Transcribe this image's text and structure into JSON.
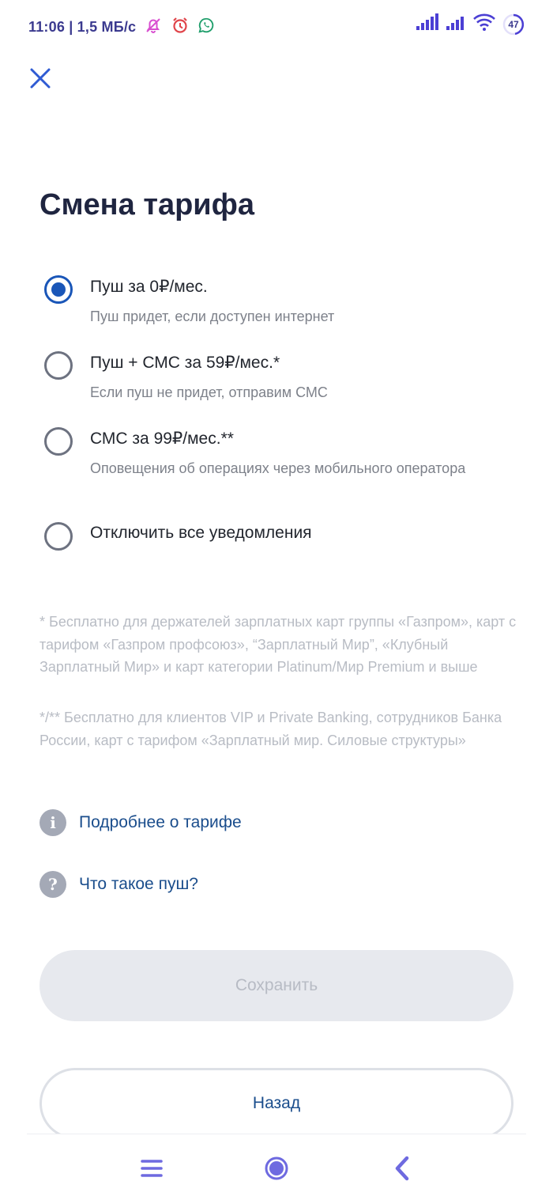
{
  "status_bar": {
    "time_speed": "11:06 | 1,5 МБ/с",
    "battery": "47"
  },
  "title": "Смена тарифа",
  "options": [
    {
      "label": "Пуш за 0₽/мес.",
      "description": "Пуш придет, если доступен интернет",
      "selected": true
    },
    {
      "label": "Пуш + СМС за 59₽/мес.*",
      "description": "Если пуш не придет, отправим СМС",
      "selected": false
    },
    {
      "label": "СМС за 99₽/мес.**",
      "description": "Оповещения об операциях через мобильного оператора",
      "selected": false
    },
    {
      "label": "Отключить все уведомления",
      "description": "",
      "selected": false
    }
  ],
  "footnotes": [
    "* Бесплатно для держателей зарплатных карт группы «Газпром», карт с тарифом «Газпром профсоюз», “Зарплатный Мир”, «Клубный Зарплатный Мир» и карт категории Platinum/Мир Premium и выше",
    "*/** Бесплатно для клиентов VIP и Private Banking, сотрудников Банка России, карт с тарифом «Зарплатный мир. Силовые структуры»"
  ],
  "links": {
    "tariff_info": "Подробнее о тарифе",
    "what_is_push": "Что такое пуш?"
  },
  "buttons": {
    "save": "Сохранить",
    "back": "Назад"
  },
  "colors": {
    "accent": "#1a56b8",
    "link": "#1a4d8c",
    "title": "#1f2540",
    "nav_icons": "#6e6ae0"
  },
  "icons": {
    "close": "close-icon",
    "info": "info-icon",
    "help": "question-icon",
    "nav_menu": "menu-icon",
    "nav_home": "home-circle-icon",
    "nav_back": "back-chevron-icon"
  }
}
